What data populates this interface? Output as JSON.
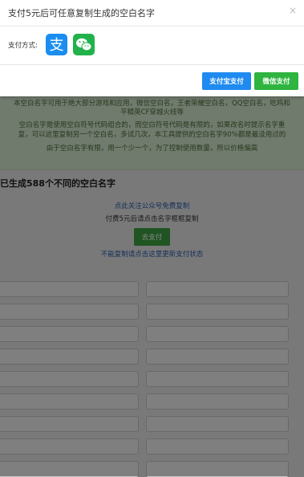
{
  "modal": {
    "title": "支付5元后可任意复制生成的空白名字",
    "close_glyph": "×",
    "pay_method_label": "支付方式:",
    "alipay_icon": "alipay-icon",
    "wechat_icon": "wechat-icon",
    "alipay_button": "支付宝支付",
    "wechat_button": "微信支付"
  },
  "background": {
    "info": [
      "本空白名字可用于绝大部分游戏和应用，微信空白名，王者荣耀空白名，QQ空白名，吃鸡和",
      "平精英CF穿越火线等",
      "空白名字是使用空白符号代码组合的，而空白符号代码是有限的，如果改名时提示名字重",
      "复，可以这里复制另一个空白名，多试几次，本工具提供的空白名字90%都是最没用过的",
      "由于空白名字有限，用一个少一个，为了控制使用数量，所以价格偏高"
    ],
    "generated_title": "已生成588个不同的空白名字",
    "follow_link": "点此关注公众号免费复制",
    "after_pay_hint": "付费5元后请点击名字框框复制",
    "go_pay_button": "去支付",
    "refresh_link": "不能复制请点击这里更新支付状态"
  },
  "colors": {
    "alipay": "#1a8ef0",
    "wechat": "#22b24c",
    "info_bg": "#d6ead2"
  }
}
